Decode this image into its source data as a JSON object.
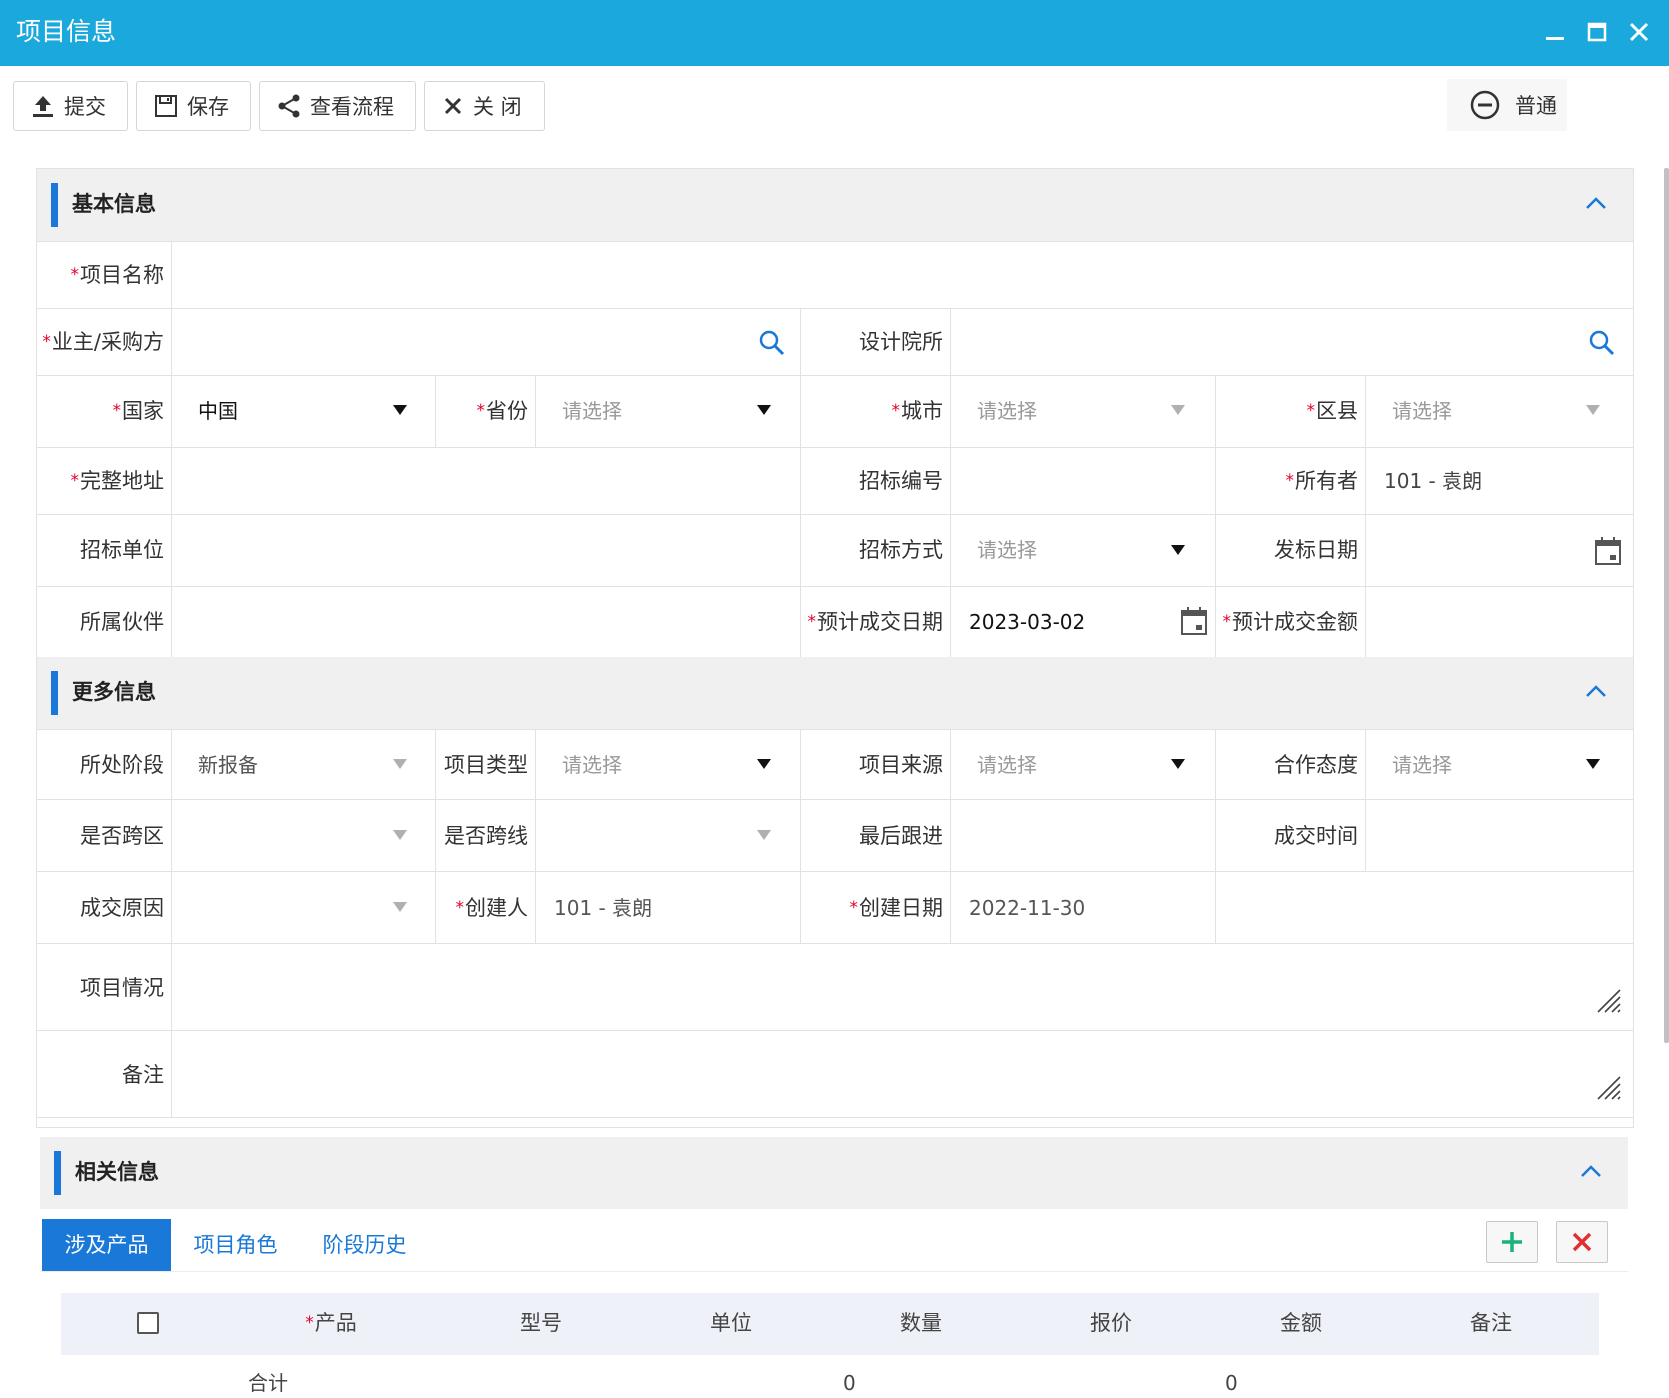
{
  "window": {
    "title": "项目信息"
  },
  "toolbar": {
    "submit": "提交",
    "save": "保存",
    "view_flow": "查看流程",
    "close": "关 闭",
    "mode": "普通"
  },
  "sections": {
    "basic": "基本信息",
    "more": "更多信息",
    "related": "相关信息"
  },
  "basic": {
    "project_name": {
      "label": "项目名称",
      "value": ""
    },
    "owner_buyer": {
      "label": "业主/采购方",
      "value": ""
    },
    "design_institute": {
      "label": "设计院所",
      "value": ""
    },
    "country": {
      "label": "国家",
      "value": "中国"
    },
    "province": {
      "label": "省份",
      "placeholder": "请选择"
    },
    "city": {
      "label": "城市",
      "placeholder": "请选择"
    },
    "district": {
      "label": "区县",
      "placeholder": "请选择"
    },
    "full_address": {
      "label": "完整地址",
      "value": ""
    },
    "bid_number": {
      "label": "招标编号",
      "value": ""
    },
    "owner": {
      "label": "所有者",
      "value": "101 - 袁朗"
    },
    "bid_unit": {
      "label": "招标单位",
      "value": ""
    },
    "bid_method": {
      "label": "招标方式",
      "placeholder": "请选择"
    },
    "bid_date": {
      "label": "发标日期",
      "value": ""
    },
    "partner": {
      "label": "所属伙伴",
      "value": ""
    },
    "expected_close_date": {
      "label": "预计成交日期",
      "value": "2023-03-02"
    },
    "expected_amount": {
      "label": "预计成交金额",
      "value": ""
    }
  },
  "more": {
    "stage": {
      "label": "所处阶段",
      "value": "新报备"
    },
    "project_type": {
      "label": "项目类型",
      "placeholder": "请选择"
    },
    "project_source": {
      "label": "项目来源",
      "placeholder": "请选择"
    },
    "cooperation": {
      "label": "合作态度",
      "placeholder": "请选择"
    },
    "cross_region": {
      "label": "是否跨区",
      "value": ""
    },
    "cross_line": {
      "label": "是否跨线",
      "value": ""
    },
    "last_follow": {
      "label": "最后跟进",
      "value": ""
    },
    "close_time": {
      "label": "成交时间",
      "value": ""
    },
    "close_reason": {
      "label": "成交原因",
      "value": ""
    },
    "creator": {
      "label": "创建人",
      "value": "101 - 袁朗"
    },
    "create_date": {
      "label": "创建日期",
      "value": "2022-11-30"
    },
    "situation": {
      "label": "项目情况",
      "value": ""
    },
    "remark": {
      "label": "备注",
      "value": ""
    }
  },
  "tabs": [
    "涉及产品",
    "项目角色",
    "阶段历史"
  ],
  "grid": {
    "columns": [
      "产品",
      "型号",
      "单位",
      "数量",
      "报价",
      "金额",
      "备注"
    ],
    "footer": {
      "label": "合计",
      "quantity_total": "0",
      "amount_total": "0"
    }
  },
  "colors": {
    "titlebar": "#1ba8dc",
    "accent": "#1a78d8",
    "required": "#e4002b"
  }
}
